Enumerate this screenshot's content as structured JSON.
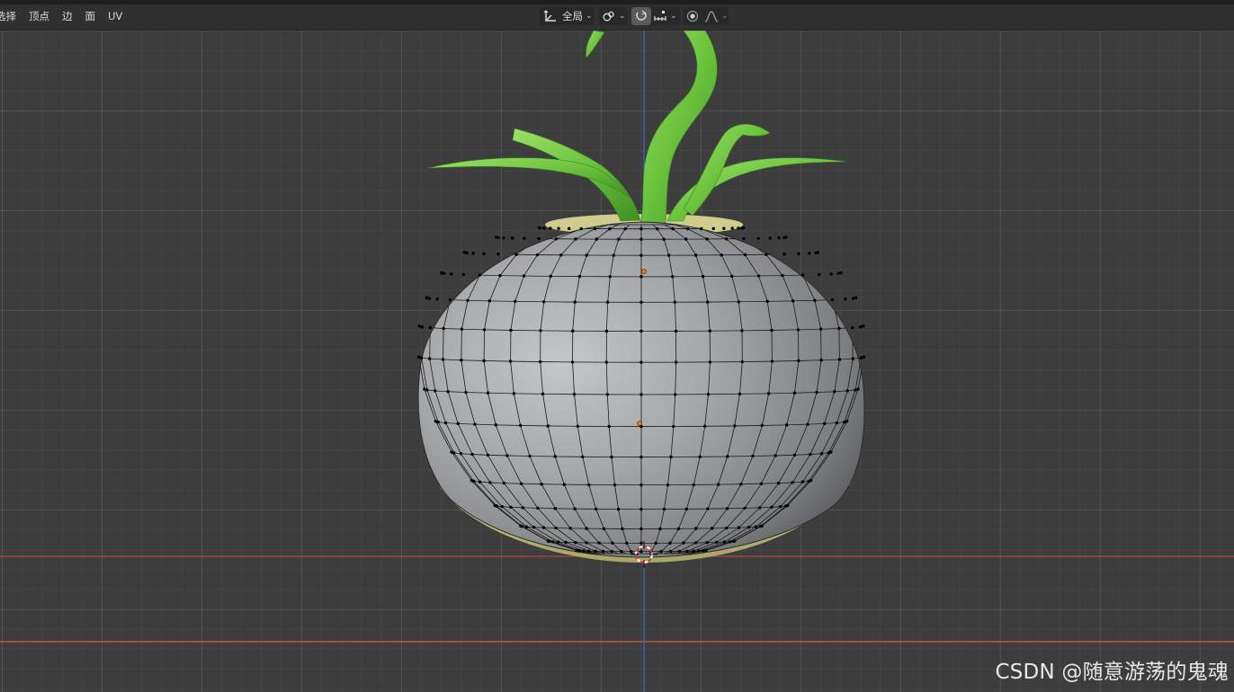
{
  "menu": {
    "items": [
      "选择",
      "顶点",
      "边",
      "面",
      "UV"
    ]
  },
  "toolbar": {
    "transform_orientation": "全局",
    "orientation_icon": "transform-axes-icon",
    "pivot_icon": "link-rings-icon",
    "snap_icon": "magnet-snap-icon",
    "snap_target_icon": "snap-increment-icon",
    "proportional_icon": "proportional-editing-icon",
    "falloff_icon": "falloff-curve-icon"
  },
  "watermark": "CSDN @随意游荡的鬼魂",
  "colors": {
    "x_axis": "#c44a4a",
    "z_axis": "#3c6fc4",
    "mesh_vertex": "#000000",
    "active_origin": "#e07a1f",
    "leaf_green": "#6ec23e",
    "bulb_gray": "#a6a8aa",
    "bulb_base": "#c8c68a"
  }
}
